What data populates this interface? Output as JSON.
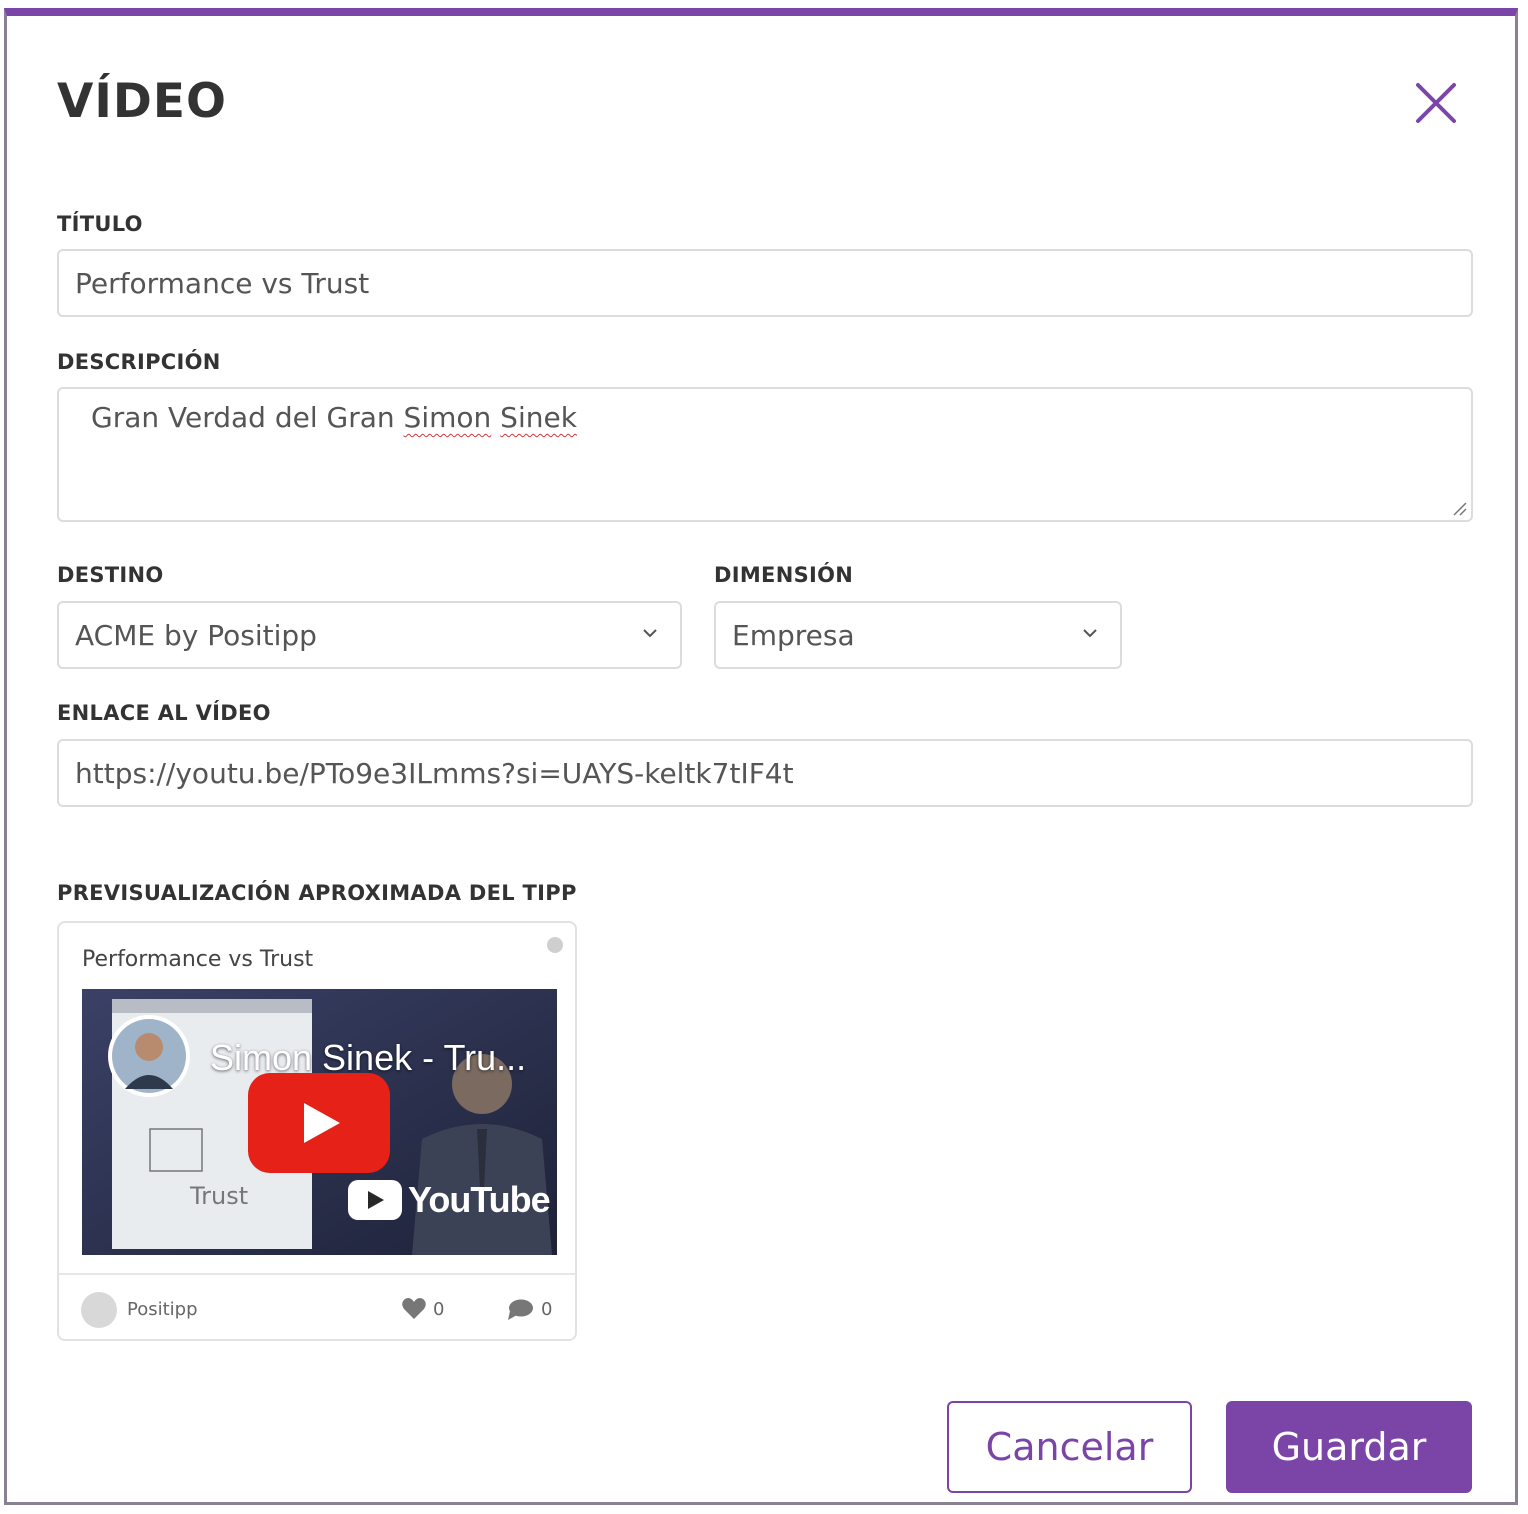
{
  "dialog": {
    "title": "VÍDEO",
    "close_icon": "close-icon"
  },
  "fields": {
    "titulo_label": "TÍTULO",
    "titulo_value": "Performance vs Trust",
    "descripcion_label": "DESCRIPCIÓN",
    "descripcion_value_part1": "Gran Verdad del Gran ",
    "descripcion_value_part2": "Simon",
    "descripcion_value_part3": " ",
    "descripcion_value_part4": "Sinek",
    "destino_label": "DESTINO",
    "destino_value": "ACME by Positipp",
    "dimension_label": "DIMENSIÓN",
    "dimension_value": "Empresa",
    "enlace_label": "ENLACE AL VÍDEO",
    "enlace_value": "https://youtu.be/PTo9e3ILmms?si=UAYS-keltk7tIF4t"
  },
  "preview": {
    "label": "PREVISUALIZACIÓN APROXIMADA DEL TIPP",
    "card_title": "Performance vs Trust",
    "video_title": "Simon Sinek - Tru...",
    "youtube_brand": "YouTube",
    "whiteboard_text": "Trust",
    "author": "Positipp",
    "likes": "0",
    "comments": "0"
  },
  "actions": {
    "cancel_label": "Cancelar",
    "save_label": "Guardar"
  },
  "colors": {
    "accent": "#7b45a8",
    "youtube_red": "#e62117"
  }
}
